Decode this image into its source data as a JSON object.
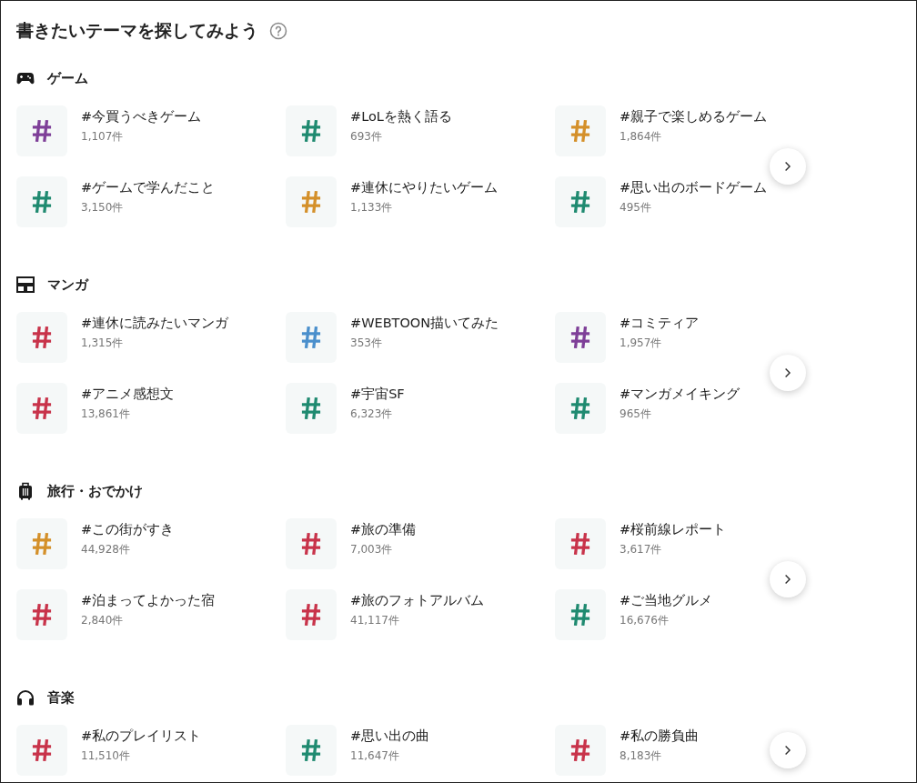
{
  "title": "書きたいテーマを探してみよう",
  "sections": [
    {
      "kind": "gamepad",
      "label": "ゲーム",
      "themes": [
        {
          "tag": "#今買うべきゲーム",
          "count": "1,107件",
          "color": "#7e3f98"
        },
        {
          "tag": "#LoLを熱く語る",
          "count": "693件",
          "color": "#1f8a70"
        },
        {
          "tag": "#親子で楽しめるゲーム",
          "count": "1,864件",
          "color": "#d4902a"
        },
        {
          "tag": "#ゲームで学んだこと",
          "count": "3,150件",
          "color": "#1f8a70"
        },
        {
          "tag": "#連休にやりたいゲーム",
          "count": "1,133件",
          "color": "#d4902a"
        },
        {
          "tag": "#思い出のボードゲーム",
          "count": "495件",
          "color": "#1f8a70"
        }
      ]
    },
    {
      "kind": "manga",
      "label": "マンガ",
      "themes": [
        {
          "tag": "#連休に読みたいマンガ",
          "count": "1,315件",
          "color": "#c8334a"
        },
        {
          "tag": "#WEBTOON描いてみた",
          "count": "353件",
          "color": "#4a8fcc"
        },
        {
          "tag": "#コミティア",
          "count": "1,957件",
          "color": "#7e3f98"
        },
        {
          "tag": "#アニメ感想文",
          "count": "13,861件",
          "color": "#c8334a"
        },
        {
          "tag": "#宇宙SF",
          "count": "6,323件",
          "color": "#1f8a70"
        },
        {
          "tag": "#マンガメイキング",
          "count": "965件",
          "color": "#1f8a70"
        }
      ]
    },
    {
      "kind": "suitcase",
      "label": "旅行・おでかけ",
      "themes": [
        {
          "tag": "#この街がすき",
          "count": "44,928件",
          "color": "#d4902a"
        },
        {
          "tag": "#旅の準備",
          "count": "7,003件",
          "color": "#c8334a"
        },
        {
          "tag": "#桜前線レポート",
          "count": "3,617件",
          "color": "#c8334a"
        },
        {
          "tag": "#泊まってよかった宿",
          "count": "2,840件",
          "color": "#c8334a"
        },
        {
          "tag": "#旅のフォトアルバム",
          "count": "41,117件",
          "color": "#c8334a"
        },
        {
          "tag": "#ご当地グルメ",
          "count": "16,676件",
          "color": "#1f8a70"
        }
      ]
    },
    {
      "kind": "headphones",
      "label": "音楽",
      "themes": [
        {
          "tag": "#私のプレイリスト",
          "count": "11,510件",
          "color": "#c8334a"
        },
        {
          "tag": "#思い出の曲",
          "count": "11,647件",
          "color": "#1f8a70"
        },
        {
          "tag": "#私の勝負曲",
          "count": "8,183件",
          "color": "#c8334a"
        }
      ]
    }
  ]
}
